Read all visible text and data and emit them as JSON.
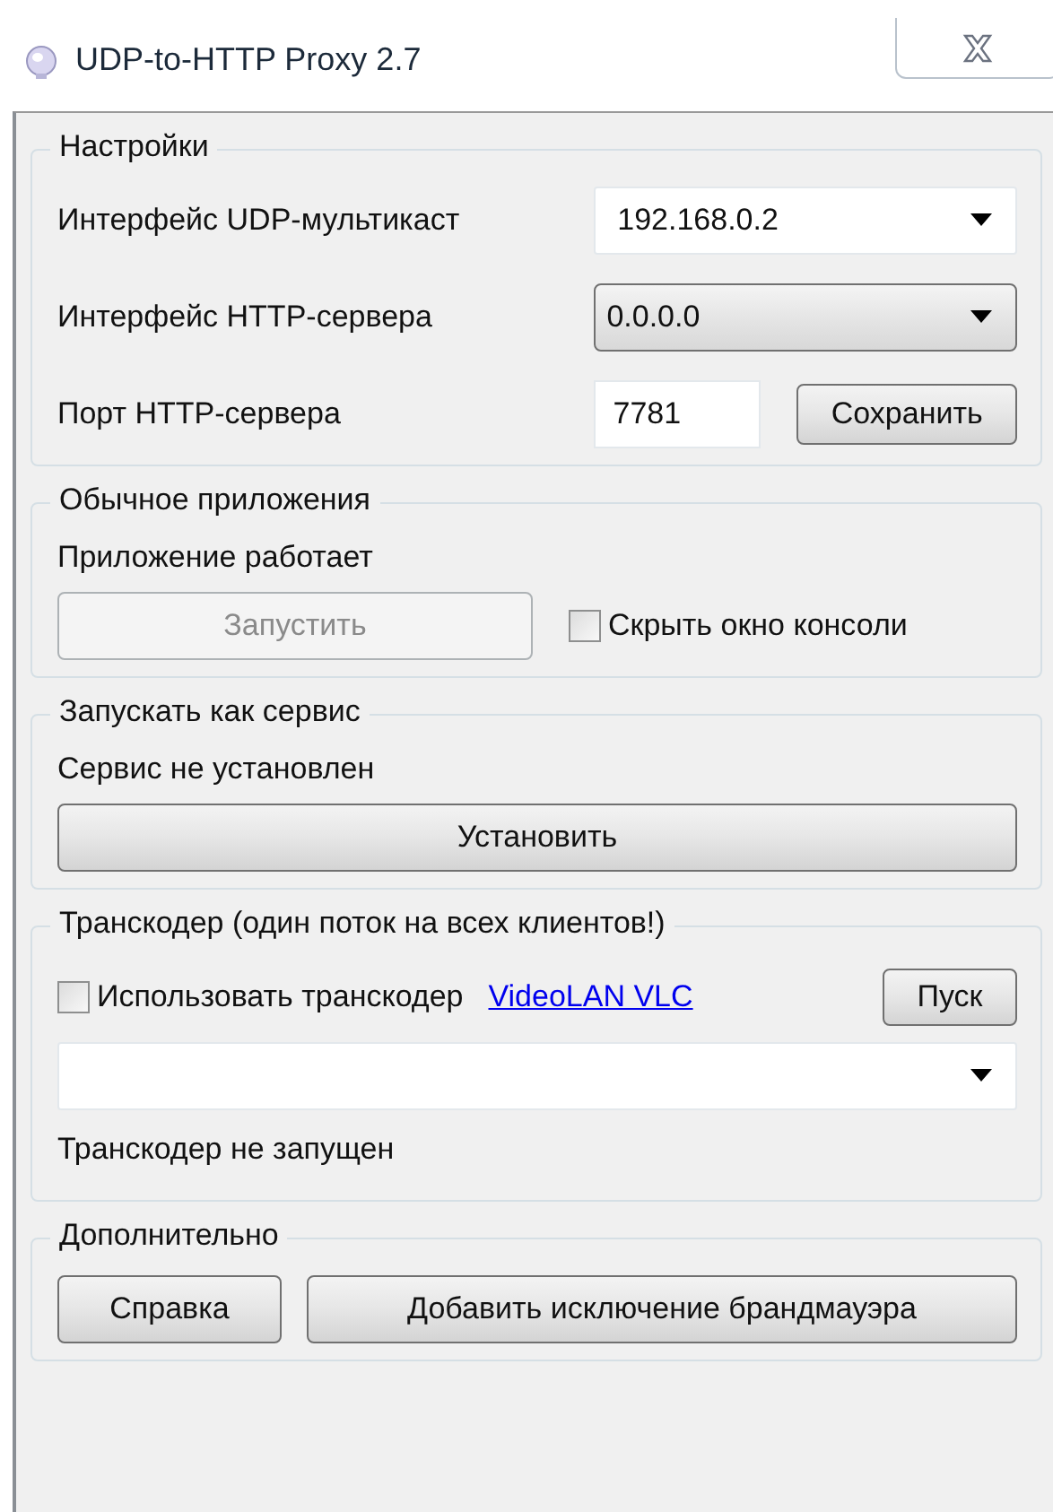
{
  "window": {
    "title": "UDP-to-HTTP Proxy 2.7"
  },
  "settings": {
    "legend": "Настройки",
    "rows": [
      {
        "kind": "editable-combo",
        "label": "Интерфейс UDP-мультикаст",
        "value": "192.168.0.2"
      },
      {
        "kind": "dropdown",
        "label": "Интерфейс HTTP-сервера",
        "value": "0.0.0.0"
      },
      {
        "kind": "port",
        "label": "Порт HTTP-сервера",
        "value": "7781",
        "button": "Сохранить"
      }
    ]
  },
  "app": {
    "legend": "Обычное приложения",
    "status": "Приложение работает",
    "run_button": {
      "label": "Запустить",
      "disabled": true
    },
    "hide_console": {
      "label": "Скрыть окно консоли",
      "checked": false
    }
  },
  "service": {
    "legend": "Запускать как сервис",
    "status": "Сервис не установлен",
    "install_button": {
      "label": "Установить",
      "disabled": false
    }
  },
  "transcoder": {
    "legend": "Транскодер (один поток на всех клиентов!)",
    "use": {
      "label": "Использовать транскодер",
      "checked": false
    },
    "link": "VideoLAN VLC",
    "start_button": "Пуск",
    "status": "Транскодер не запущен"
  },
  "extra": {
    "legend": "Дополнительно",
    "buttons": [
      "Справка",
      "Добавить исключение брандмауэра"
    ]
  }
}
